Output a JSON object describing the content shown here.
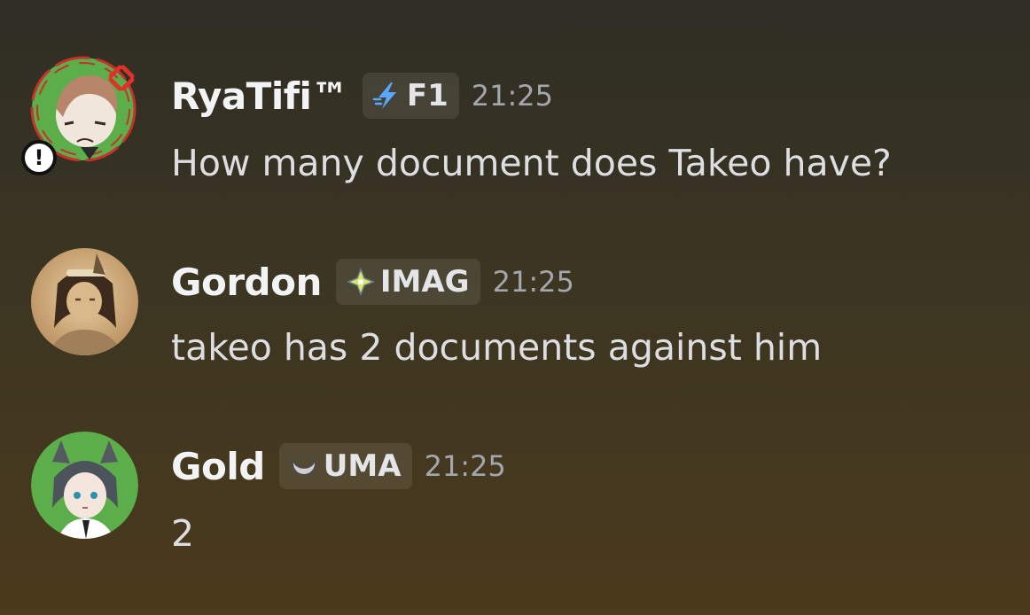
{
  "messages": [
    {
      "username": "RyaTifi™",
      "tag": {
        "icon": "lightning-bolt-icon",
        "text": "F1",
        "icon_color": "#5aa7ff"
      },
      "timestamp": "21:25",
      "content": "How many document does Takeo have?",
      "avatar": {
        "name": "angry-anime-character-avatar",
        "ring_color": "#5cae4a",
        "decoration": "red-anger-ring",
        "badge_text": "!"
      }
    },
    {
      "username": "Gordon",
      "tag": {
        "icon": "four-point-star-icon",
        "text": "IMAG",
        "icon_color": "#d7e86a"
      },
      "timestamp": "21:25",
      "content": "takeo has 2 documents against him",
      "avatar": {
        "name": "sepia-portrait-avatar",
        "ring_color": "#c9a87a"
      }
    },
    {
      "username": "Gold",
      "tag": {
        "icon": "crescent-moon-icon",
        "text": "UMA",
        "icon_color": "#cfcfcf"
      },
      "timestamp": "21:25",
      "content": "2",
      "avatar": {
        "name": "horse-girl-avatar",
        "ring_color": "#5cae4a"
      }
    }
  ]
}
